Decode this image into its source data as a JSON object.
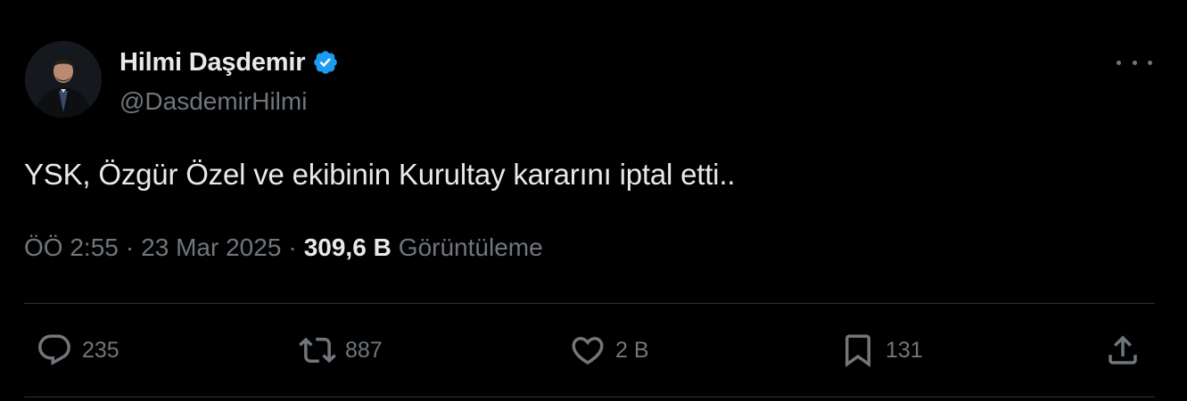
{
  "author": {
    "display_name": "Hilmi Daşdemir",
    "handle": "@DasdemirHilmi",
    "verified": true
  },
  "tweet": {
    "text": "YSK, Özgür Özel ve ekibinin Kurultay kararını iptal etti..",
    "time": "ÖÖ 2:55",
    "date": "23 Mar 2025",
    "separator": "·",
    "views_count": "309,6 B",
    "views_label": "Görüntüleme"
  },
  "actions": {
    "replies": "235",
    "retweets": "887",
    "likes": "2 B",
    "bookmarks": "131"
  },
  "icons": {
    "verified": "verified-badge-icon",
    "more": "more-horizontal-icon",
    "reply": "reply-bubble-icon",
    "retweet": "retweet-icon",
    "like": "heart-icon",
    "bookmark": "bookmark-icon",
    "share": "share-upload-icon"
  },
  "colors": {
    "background": "#000000",
    "primary_text": "#e7e9ea",
    "secondary_text": "#71767b",
    "divider": "#2f3336",
    "verified_blue": "#1d9bf0"
  }
}
